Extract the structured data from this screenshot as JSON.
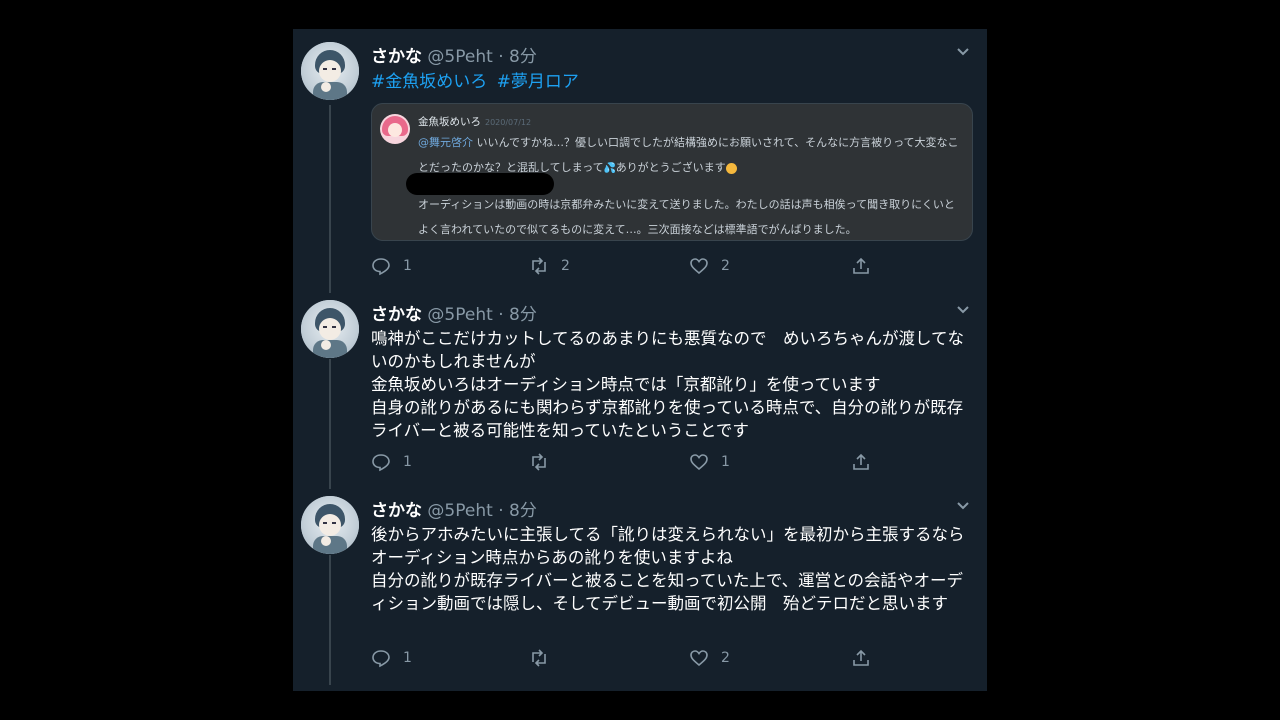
{
  "tweets": [
    {
      "name": "さかな",
      "handle": "@5Peht",
      "time": "8分",
      "hashtags": [
        "#金魚坂めいろ",
        "#夢月ロア"
      ],
      "quote": {
        "name": "金魚坂めいろ",
        "date": "2020/07/12",
        "mention": "@舞元啓介",
        "text_a": " いいんですかね…？優しい口調でしたが結構強めにお願いされて、そんなに方言被りって大変なことだったのかな？と混乱してしまって",
        "text_b": "ありがとうございます",
        "text_c": "オーディションは動画の時は京都弁みたいに変えて送りました。わたしの話は声も相俟って聞き取りにくいとよく言われていたので似てるものに変えて…。三次面接などは標準語でがんばりました。"
      },
      "replies": "1",
      "retweets": "2",
      "likes": "2"
    },
    {
      "name": "さかな",
      "handle": "@5Peht",
      "time": "8分",
      "text": "鳴神がここだけカットしてるのあまりにも悪質なので　めいろちゃんが渡してないのかもしれませんが\n金魚坂めいろはオーディション時点では「京都訛り」を使っています\n自身の訛りがあるにも関わらず京都訛りを使っている時点で、自分の訛りが既存ライバーと被る可能性を知っていたということです",
      "replies": "1",
      "retweets": "",
      "likes": "1"
    },
    {
      "name": "さかな",
      "handle": "@5Peht",
      "time": "8分",
      "text": "後からアホみたいに主張してる「訛りは変えられない」を最初から主張するならオーディション時点からあの訛りを使いますよね\n自分の訛りが既存ライバーと被ることを知っていた上で、運営との会話やオーディション動画では隠し、そしてデビュー動画で初公開　殆どテロだと思います",
      "replies": "1",
      "retweets": "",
      "likes": "2"
    }
  ],
  "colors": {
    "background": "#15202b",
    "text": "#ffffff",
    "secondary": "#8899a6",
    "link": "#1da1f2"
  }
}
